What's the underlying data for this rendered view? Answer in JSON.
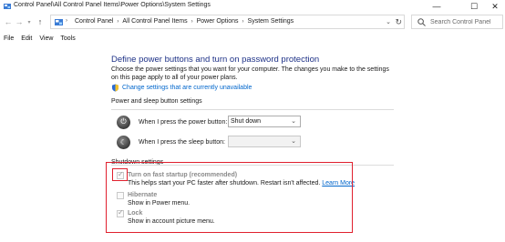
{
  "window": {
    "title": "Control Panel\\All Control Panel Items\\Power Options\\System Settings",
    "minimize_glyph": "—",
    "maximize_glyph": "☐",
    "close_glyph": "✕"
  },
  "address_bar": {
    "crumbs": [
      "Control Panel",
      "All Control Panel Items",
      "Power Options",
      "System Settings"
    ],
    "separator": "›",
    "search_placeholder": "Search Control Panel"
  },
  "menu": [
    "File",
    "Edit",
    "View",
    "Tools"
  ],
  "page": {
    "heading": "Define power buttons and turn on password protection",
    "description": "Choose the power settings that you want for your computer. The changes you make to the settings on this page apply to all of your power plans.",
    "admin_link": "Change settings that are currently unavailable"
  },
  "power_sleep": {
    "title": "Power and sleep button settings",
    "power_label": "When I press the power button:",
    "power_value": "Shut down",
    "sleep_label": "When I press the sleep button:",
    "sleep_value": ""
  },
  "shutdown": {
    "title": "Shutdown settings",
    "options": [
      {
        "name": "Turn on fast startup (recommended)",
        "checked": true,
        "desc": "This helps start your PC faster after shutdown. Restart isn't affected.",
        "link": "Learn More"
      },
      {
        "name": "Hibernate",
        "checked": false,
        "desc": "Show in Power menu."
      },
      {
        "name": "Lock",
        "checked": true,
        "desc": "Show in account picture menu."
      }
    ]
  },
  "colors": {
    "highlight": "#e0202e",
    "heading": "#1e3287",
    "link": "#0066cc"
  },
  "icons": {
    "app": "control-panel-icon",
    "back": "back-arrow-icon",
    "forward": "forward-arrow-icon",
    "recent": "chevron-down-icon",
    "up": "up-arrow-icon",
    "refresh": "refresh-icon",
    "search": "search-icon",
    "shield": "shield-icon",
    "power": "power-icon",
    "sleep": "moon-icon"
  }
}
